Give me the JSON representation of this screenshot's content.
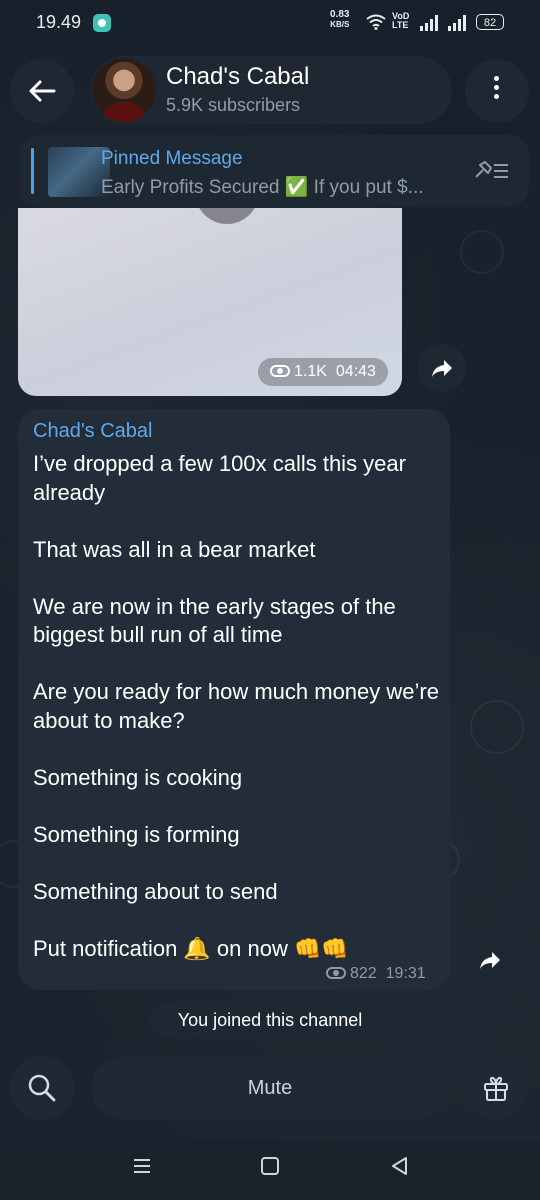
{
  "status_bar": {
    "time": "19.49",
    "net_speed_value": "0.83",
    "net_speed_unit": "KB/S",
    "network_label_top": "VoD",
    "network_label_bottom": "LTE",
    "battery": "82"
  },
  "header": {
    "title": "Chad's Cabal",
    "subtitle": "5.9K subscribers"
  },
  "pinned": {
    "title": "Pinned Message",
    "text": "Early Profits Secured ✅  If you put $..."
  },
  "media_message": {
    "views": "1.1K",
    "time": "04:43"
  },
  "text_message": {
    "author": "Chad's Cabal",
    "lines": [
      "I’ve dropped a few 100x calls this year already",
      "That was all in a bear market",
      "We are now in the early stages of the biggest bull run of all time",
      "Are you ready for how much money we’re about to make?",
      "Something is cooking",
      "Something is forming",
      "Something about to send",
      "Put notification 🔔 on now 👊👊"
    ],
    "views": "822",
    "time": "19:31"
  },
  "service_message": "You joined this channel",
  "bottom_bar": {
    "mute_label": "Mute"
  },
  "icons": [
    "back-arrow-icon",
    "more-vertical-icon",
    "unpin-list-icon",
    "forward-icon",
    "eye-icon",
    "search-icon",
    "gift-icon",
    "recents-icon",
    "home-icon",
    "back-triangle-icon"
  ],
  "colors": {
    "accent_blue": "#5fa8ec",
    "bubble_bg": "#222d39",
    "app_bg": "#1a222c"
  }
}
